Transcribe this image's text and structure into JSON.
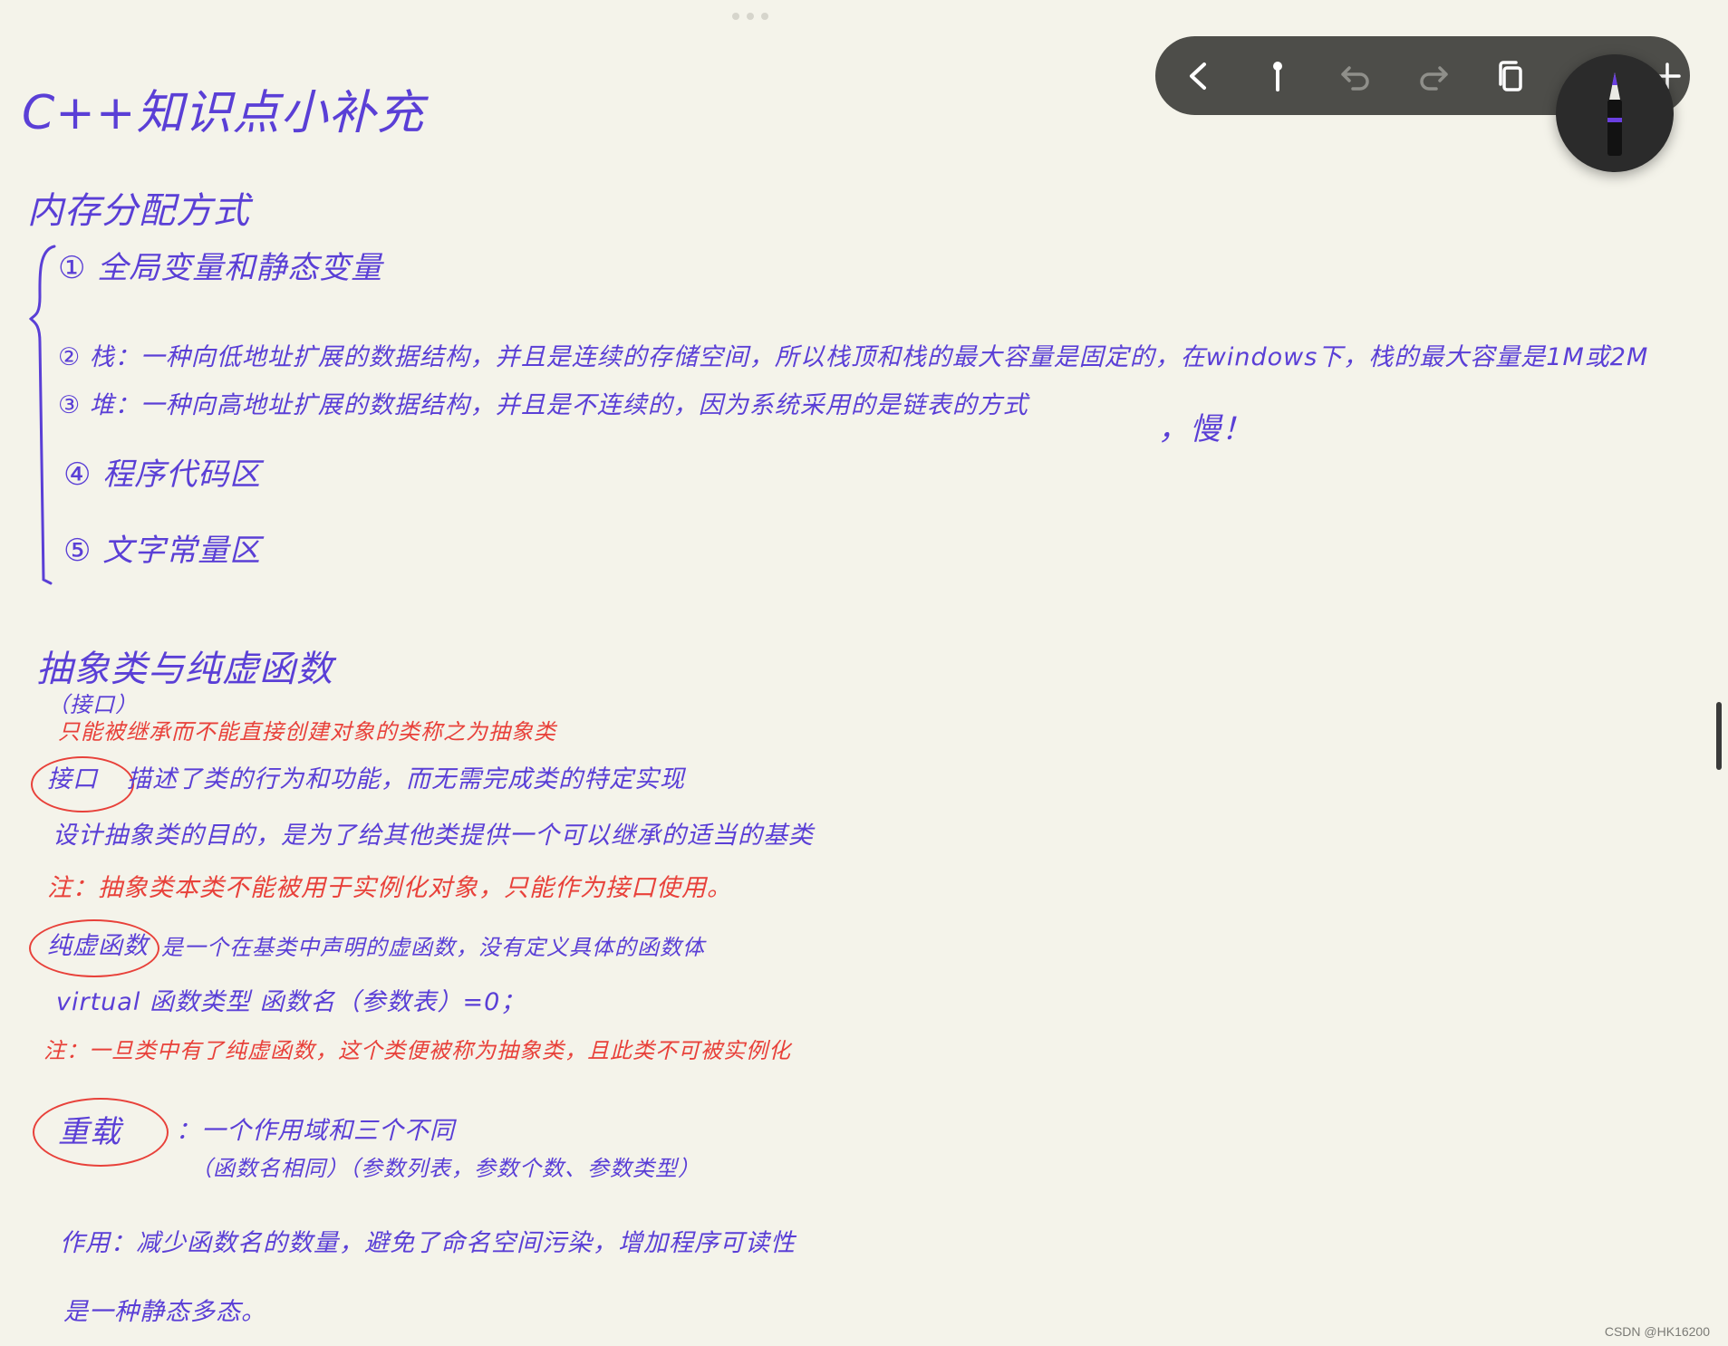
{
  "note": {
    "title": "C++知识点小补充",
    "memory": {
      "heading": "内存分配方式",
      "items": [
        "① 全局变量和静态变量",
        "② 栈：一种向低地址扩展的数据结构，并且是连续的存储空间，所以栈顶和栈的最大容量是固定的，在windows下，栈的最大容量是1M或2M",
        "③ 堆：一种向高地址扩展的数据结构，并且是不连续的，因为系统采用的是链表的方式",
        "④ 程序代码区",
        "⑤ 文字常量区"
      ],
      "heap_note": "，慢！"
    },
    "abstract": {
      "heading": "抽象类与纯虚函数",
      "sub": "（接口）",
      "red_def": "只能被继承而不能直接创建对象的类称之为抽象类",
      "interface_word": "接口",
      "interface_desc": "描述了类的行为和功能，而无需完成类的特定实现",
      "purpose": "设计抽象类的目的，是为了给其他类提供一个可以继承的适当的基类",
      "note1": "注：抽象类本类不能被用于实例化对象，只能作为接口使用。",
      "pure_word": "纯虚函数",
      "pure_desc": "是一个在基类中声明的虚函数，没有定义具体的函数体",
      "syntax": "virtual 函数类型 函数名（参数表）=0；",
      "note2": "注：一旦类中有了纯虚函数，这个类便被称为抽象类，且此类不可被实例化"
    },
    "overload": {
      "word": "重载",
      "desc": "：一个作用域和三个不同",
      "details": "（函数名相同）（参数列表，参数个数、参数类型）",
      "effect": "作用：减少函数名的数量，避免了命名空间污染，增加程序可读性",
      "kind": "是一种静态多态。"
    }
  },
  "toolbar": {
    "icons": [
      "back-icon",
      "pin-icon",
      "undo-icon",
      "redo-icon",
      "copy-icon",
      "lasso-icon",
      "add-icon"
    ]
  },
  "pen_tool": {
    "icon": "pen-icon",
    "accent": "#6a3fe0"
  },
  "watermark": "CSDN @HK16200",
  "colors": {
    "ink_purple": "#5a3fd6",
    "ink_red": "#e8413a",
    "paper": "#f4f3ea"
  }
}
